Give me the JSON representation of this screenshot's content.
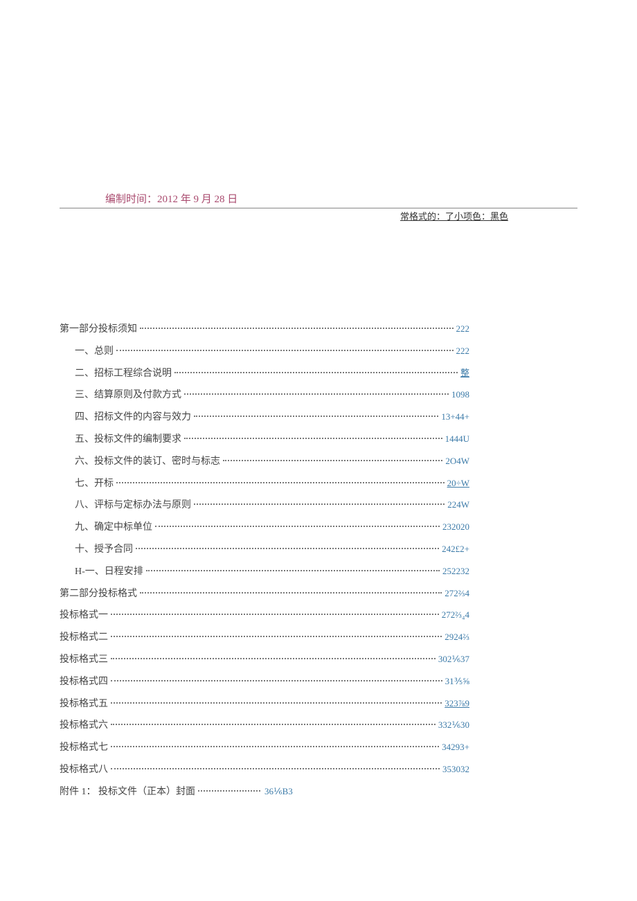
{
  "header": {
    "compile_time": "编制时间：2012 年 9 月 28 日",
    "format_note": "常格式的：了小项色：黑色"
  },
  "toc": [
    {
      "label": "第一部分投标须知",
      "page": "222",
      "indent": false,
      "underline": false
    },
    {
      "label": "一、总则",
      "page": "222",
      "indent": true,
      "underline": false
    },
    {
      "label": "二、招标工程综合说明",
      "page": "整",
      "indent": true,
      "underline": true
    },
    {
      "label": "三、结算原则及付款方式",
      "page": "1098",
      "indent": true,
      "underline": false
    },
    {
      "label": "四、招标文件的内容与效力",
      "page": "13+44+",
      "indent": true,
      "underline": false
    },
    {
      "label": "五、投标文件的编制要求",
      "page": "1444U",
      "indent": true,
      "underline": false
    },
    {
      "label": "六、投标文件的装订、密时与标志",
      "page": "2O4W",
      "indent": true,
      "underline": false
    },
    {
      "label": "七、开标",
      "page": "20÷W",
      "indent": true,
      "underline": true
    },
    {
      "label": "八、评标与定标办法与原则",
      "page": "224W",
      "indent": true,
      "underline": false
    },
    {
      "label": "九、确定中标单位",
      "page": "232020",
      "indent": true,
      "underline": false
    },
    {
      "label": "十、授予合同",
      "page": "242£2+",
      "indent": true,
      "underline": false
    },
    {
      "label": "H-一、日程安排",
      "page": "252232",
      "indent": true,
      "underline": false
    },
    {
      "label": "第二部分投标格式",
      "page": "272⅔4",
      "indent": false,
      "underline": false
    },
    {
      "label": "投标格式一",
      "page": "272⅔₄4",
      "indent": false,
      "underline": false
    },
    {
      "label": "投标格式二",
      "page": "2924⅔",
      "indent": false,
      "underline": false
    },
    {
      "label": "投标格式三",
      "page": "302⅙37",
      "indent": false,
      "underline": false
    },
    {
      "label": "投标格式四",
      "page": "31⅗⅝",
      "indent": false,
      "underline": false
    },
    {
      "label": "投标格式五",
      "page": "323⅞9",
      "indent": false,
      "underline": true
    },
    {
      "label": "投标格式六",
      "page": "332⅙30",
      "indent": false,
      "underline": false
    },
    {
      "label": "投标格式七",
      "page": "34293+",
      "indent": false,
      "underline": false
    },
    {
      "label": "投标格式八",
      "page": "353032",
      "indent": false,
      "underline": false
    }
  ],
  "toc_last": {
    "label": "附件 1： 投标文件（正本）封面",
    "page": "36⅙B3"
  }
}
